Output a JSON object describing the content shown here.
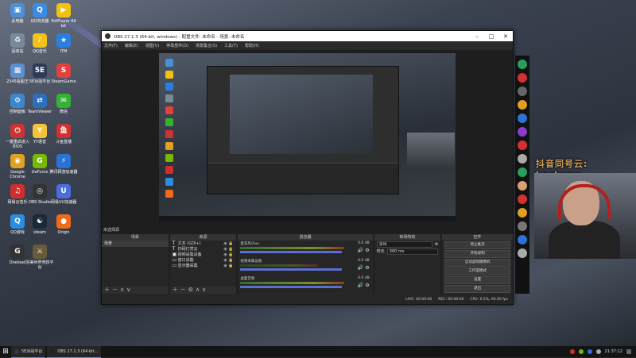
{
  "desktop": {
    "icons": [
      {
        "label": "此电脑",
        "color": "#4a90d9",
        "glyph": "▣"
      },
      {
        "label": "QQ浏览器",
        "color": "#3b8be5",
        "glyph": "Q"
      },
      {
        "label": "PotPlayer 64 bit",
        "color": "#f3c20f",
        "glyph": "▶"
      },
      {
        "label": "回收站",
        "color": "#7a8a99",
        "glyph": "♻"
      },
      {
        "label": "QQ音乐",
        "color": "#f1c21c",
        "glyph": "♪"
      },
      {
        "label": "ITM",
        "color": "#2a7ee0",
        "glyph": "★"
      },
      {
        "label": "2345看图王",
        "color": "#5b8fd0",
        "glyph": "▦"
      },
      {
        "label": "5E对战平台",
        "color": "#2f3a58",
        "glyph": "5E"
      },
      {
        "label": "SteamGame",
        "color": "#e34040",
        "glyph": "S"
      },
      {
        "label": "控制面板",
        "color": "#3c88d0",
        "glyph": "⚙"
      },
      {
        "label": "TeamViewer",
        "color": "#2c6fbf",
        "glyph": "⇄"
      },
      {
        "label": "微信",
        "color": "#33b233",
        "glyph": "✉"
      },
      {
        "label": "一键重启进入BIOS",
        "color": "#c33",
        "glyph": "⏻"
      },
      {
        "label": "YY语音",
        "color": "#f5c33b",
        "glyph": "Y"
      },
      {
        "label": "斗鱼直播",
        "color": "#d53030",
        "glyph": "鱼"
      },
      {
        "label": "Google Chrome",
        "color": "#e0a020",
        "glyph": "◉"
      },
      {
        "label": "GeForce",
        "color": "#76b900",
        "glyph": "G"
      },
      {
        "label": "腾讯网游加速器",
        "color": "#2b72d6",
        "glyph": "⚡"
      },
      {
        "label": "网易云音乐",
        "color": "#d02d2d",
        "glyph": "♫"
      },
      {
        "label": "OBS Studio",
        "color": "#333",
        "glyph": "◎"
      },
      {
        "label": "网易UU加速器",
        "color": "#4a6ee0",
        "glyph": "U"
      },
      {
        "label": "QQ游戏",
        "color": "#2b8de0",
        "glyph": "Q"
      },
      {
        "label": "steam",
        "color": "#1b2838",
        "glyph": "☯"
      },
      {
        "label": "Origin",
        "color": "#f06a1a",
        "glyph": "●"
      },
      {
        "label": "Oneload",
        "color": "#333",
        "glyph": "G"
      },
      {
        "label": "完美世界竞技平台",
        "color": "#6a5a3a",
        "glyph": "⚔"
      }
    ]
  },
  "obs": {
    "title": "OBS 27.1.3 (64-bit, windows) - 配置文件: 未命名 - 场景: 未命名",
    "menu": [
      "文件(F)",
      "编辑(E)",
      "视图(V)",
      "停靠部件(D)",
      "场景集合(S)",
      "工具(T)",
      "帮助(H)"
    ],
    "no_source_label": "未选择源",
    "docks": {
      "scenes": {
        "header": "场景",
        "items": [
          "场景"
        ]
      },
      "sources": {
        "header": "来源",
        "items": [
          {
            "icon": "T",
            "label": "文本 (GDI+)"
          },
          {
            "icon": "T",
            "label": "扫码打赏云"
          },
          {
            "icon": "▣",
            "label": "视频采集设备"
          },
          {
            "icon": "▭",
            "label": "窗口采集"
          },
          {
            "icon": "▭",
            "label": "显示器采集"
          }
        ]
      },
      "mixer": {
        "header": "混音器",
        "channels": [
          {
            "name": "麦克风/Aux",
            "db": "0.0 dB",
            "level": 0.55
          },
          {
            "name": "视频采集设备",
            "db": "0.0 dB",
            "level": 0.2
          },
          {
            "name": "桌面音频",
            "db": "0.0 dB",
            "level": 0.62
          }
        ]
      },
      "transitions": {
        "header": "转场特效",
        "type": "淡出",
        "duration_label": "时长",
        "duration": "300 ms"
      },
      "controls": {
        "header": "控件",
        "buttons": [
          "停止推流",
          "开始录制",
          "启动虚拟摄像机",
          "工作室模式",
          "设置",
          "退出"
        ]
      }
    },
    "status": {
      "live": "LIVE: 00:00:00",
      "rec": "REC: 00:00:00",
      "cpu": "CPU: 0.5%, 60.00 fps"
    }
  },
  "overlay": {
    "text": "抖音同号云: karlwow"
  },
  "taskbar": {
    "items": [
      {
        "label": "5E对战平台",
        "color": "#2f3a58"
      },
      {
        "label": "OBS 27.1.3 (64-bit...",
        "color": "#222"
      }
    ],
    "time": "21:37:12"
  }
}
